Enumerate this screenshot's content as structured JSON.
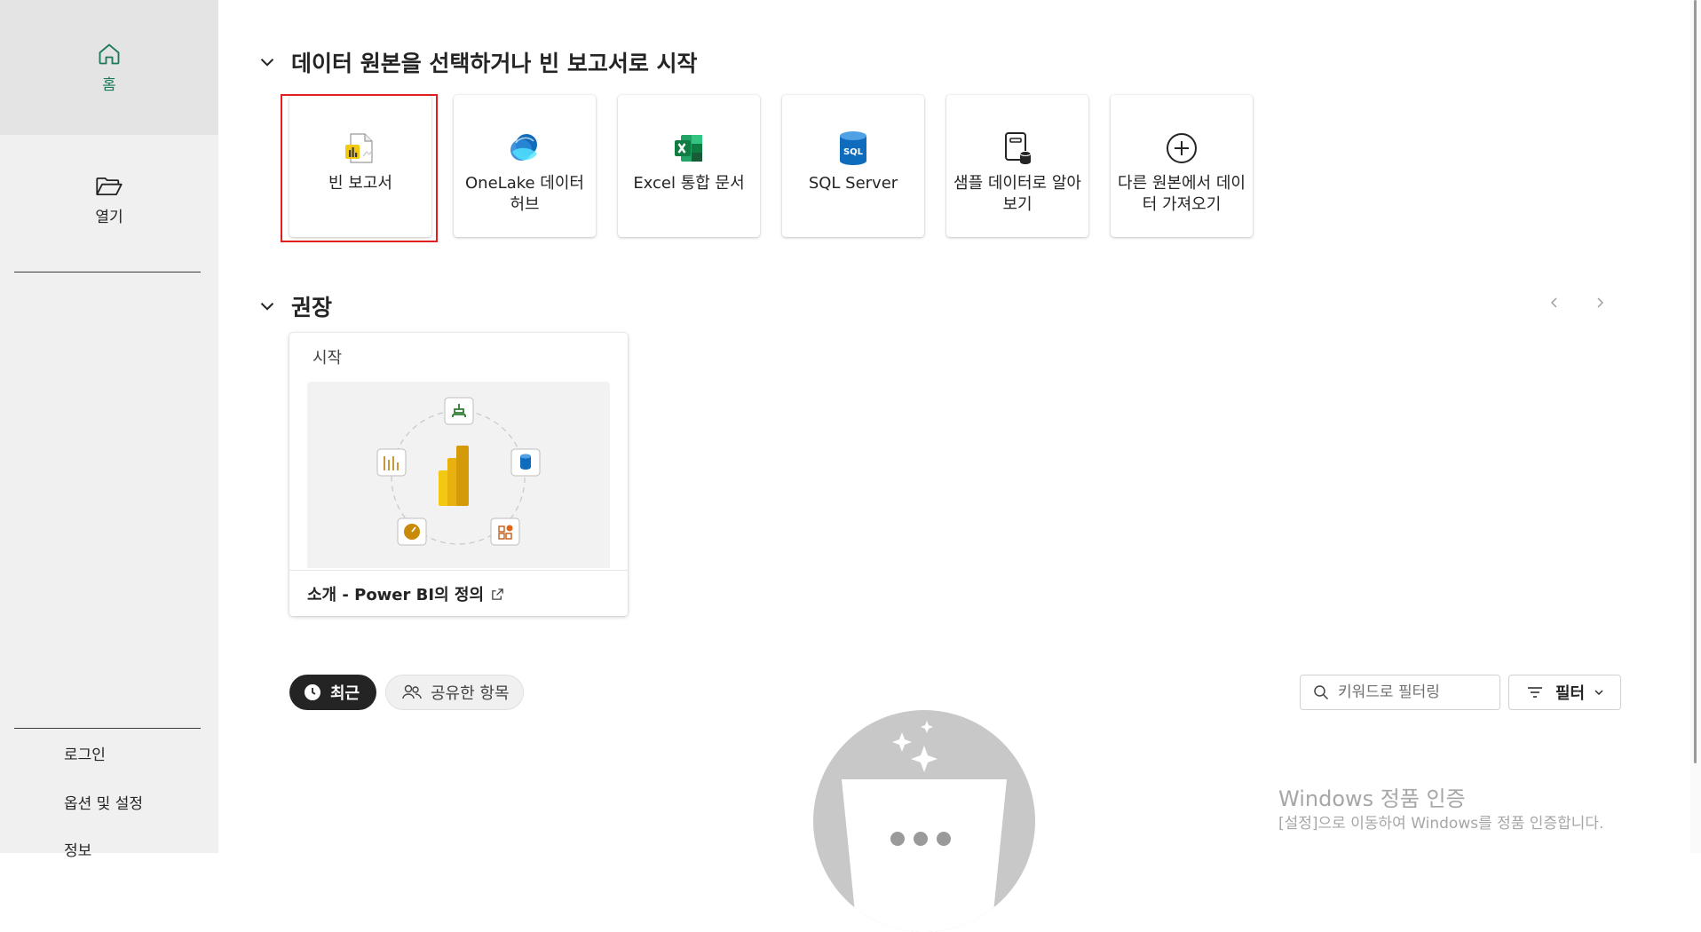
{
  "sidebar": {
    "home_label": "홈",
    "open_label": "열기",
    "signin_label": "로그인",
    "options_label": "옵션 및 설정",
    "about_label": "정보"
  },
  "start_section": {
    "title": "데이터 원본을 선택하거나 빈 보고서로 시작",
    "tiles": [
      {
        "label": "빈 보고서",
        "icon": "blank-report-icon"
      },
      {
        "label": "OneLake 데이터 허브",
        "icon": "onelake-icon"
      },
      {
        "label": "Excel 통합 문서",
        "icon": "excel-icon"
      },
      {
        "label": "SQL Server",
        "icon": "sql-server-icon"
      },
      {
        "label": "샘플 데이터로 알아보기",
        "icon": "sample-data-icon"
      },
      {
        "label": "다른 원본에서 데이터 가져오기",
        "icon": "add-circle-icon"
      }
    ]
  },
  "recommended": {
    "title": "권장",
    "card": {
      "title": "시작",
      "link": "소개 - Power BI의 정의"
    }
  },
  "list": {
    "recent_label": "최근",
    "shared_label": "공유한 항목",
    "search_placeholder": "키워드로 필터링",
    "filter_label": "필터"
  },
  "watermark": {
    "line1": "Windows 정품 인증",
    "line2": "[설정]으로 이동하여 Windows를 정품 인증합니다."
  },
  "colors": {
    "accent_green": "#1c7a5a",
    "highlight_red": "#e02020",
    "powerbi_yellow": "#f2c811"
  }
}
